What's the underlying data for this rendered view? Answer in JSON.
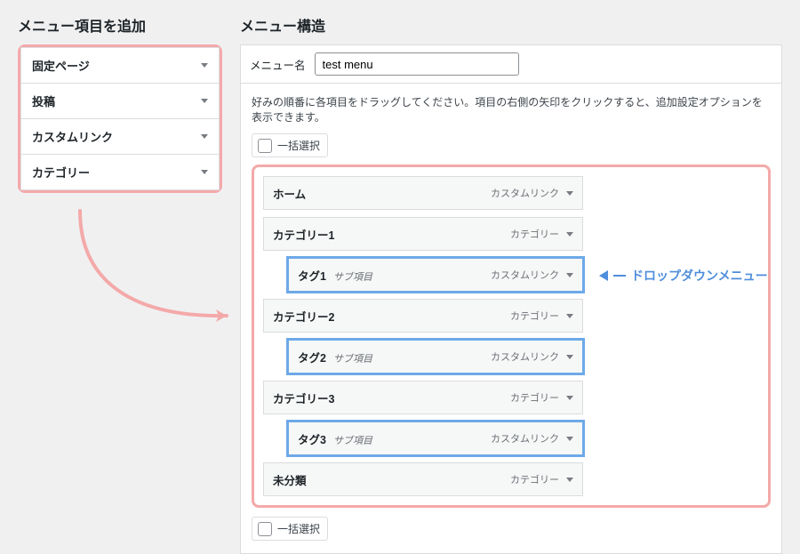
{
  "left": {
    "title": "メニュー項目を追加",
    "accordion": [
      "固定ページ",
      "投稿",
      "カスタムリンク",
      "カテゴリー"
    ]
  },
  "right": {
    "title": "メニュー構造",
    "menu_name_label": "メニュー名",
    "menu_name_value": "test menu",
    "instructions": "好みの順番に各項目をドラッグしてください。項目の右側の矢印をクリックすると、追加設定オプションを表示できます。",
    "bulk_select_label": "一括選択",
    "items": [
      {
        "title": "ホーム",
        "sub_label": "",
        "type": "カスタムリンク",
        "indent": false,
        "highlight": false
      },
      {
        "title": "カテゴリー1",
        "sub_label": "",
        "type": "カテゴリー",
        "indent": false,
        "highlight": false
      },
      {
        "title": "タグ1",
        "sub_label": "サブ項目",
        "type": "カスタムリンク",
        "indent": true,
        "highlight": true
      },
      {
        "title": "カテゴリー2",
        "sub_label": "",
        "type": "カテゴリー",
        "indent": false,
        "highlight": false
      },
      {
        "title": "タグ2",
        "sub_label": "サブ項目",
        "type": "カスタムリンク",
        "indent": true,
        "highlight": true
      },
      {
        "title": "カテゴリー3",
        "sub_label": "",
        "type": "カテゴリー",
        "indent": false,
        "highlight": false
      },
      {
        "title": "タグ3",
        "sub_label": "サブ項目",
        "type": "カスタムリンク",
        "indent": true,
        "highlight": true
      },
      {
        "title": "未分類",
        "sub_label": "",
        "type": "カテゴリー",
        "indent": false,
        "highlight": false
      }
    ]
  },
  "annotation": {
    "dropdown_label": "ドロップダウンメニュー"
  }
}
